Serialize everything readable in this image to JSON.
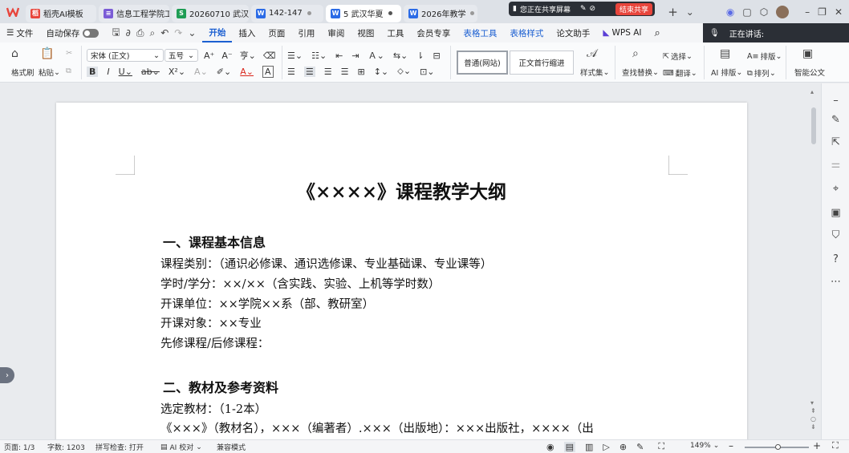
{
  "tabs": [
    {
      "label": "稻壳AI模板",
      "icon_color": "#e8453c",
      "icon": "docer-icon"
    },
    {
      "label": "信息工程学院工",
      "icon_color": "#7b5cd6",
      "icon": "doc-icon"
    },
    {
      "label": "20260710 武汉",
      "icon_color": "#1f9d55",
      "icon": "sheet-icon"
    },
    {
      "label": "142-147",
      "icon_color": "#2b6be6",
      "icon": "word-icon"
    },
    {
      "label": "5 武汉华夏",
      "icon_color": "#2b6be6",
      "icon": "word-icon"
    },
    {
      "label": "2026年教学",
      "icon_color": "#2b6be6",
      "icon": "word-icon"
    }
  ],
  "share": {
    "text": "您正在共享屏幕",
    "stop_label": "结束共享"
  },
  "menu": {
    "file": "文件",
    "autosave": "自动保存",
    "items": [
      "开始",
      "插入",
      "页面",
      "引用",
      "审阅",
      "视图",
      "工具",
      "会员专享"
    ],
    "context_items": [
      "表格工具",
      "表格样式"
    ],
    "extra_items": [
      "论文助手"
    ],
    "wps_ai": "WPS AI",
    "speaking": "正在讲话:"
  },
  "ribbon": {
    "format_painter": "格式刷",
    "paste": "粘贴",
    "font_name": "宋体 (正文)",
    "font_size": "五号",
    "style_normal": "普通(网站)",
    "style_indent": "正文首行缩进",
    "style_set": "样式集",
    "find_replace": "查找替换",
    "select": "选择",
    "translate": "翻译",
    "ai_layout": "AI 排版",
    "layout": "排版",
    "arrange": "排列",
    "smart_doc": "智能公文"
  },
  "document": {
    "title": "《××××》课程教学大纲",
    "section1_heading": "一、课程基本信息",
    "line1": "课程类别：（通识必修课、通识选修课、专业基础课、专业课等）",
    "line2": "学时/学分：××/××（含实践、实验、上机等学时数）",
    "line3": "开课单位：××学院××系（部、教研室）",
    "line4": "开课对象：××专业",
    "line5": "先修课程/后修课程：",
    "section2_heading": "二、教材及参考资料",
    "line6": "选定教材：（1-2本）",
    "line7": "《×××》（教材名），×××（编著者）.×××（出版地）：×××出版社，××××（出"
  },
  "status": {
    "page": "页面: 1/3",
    "words": "字数: 1203",
    "spell": "拼写检查: 打开",
    "ai_check": "AI 校对",
    "compat": "兼容模式",
    "zoom": "149%"
  }
}
